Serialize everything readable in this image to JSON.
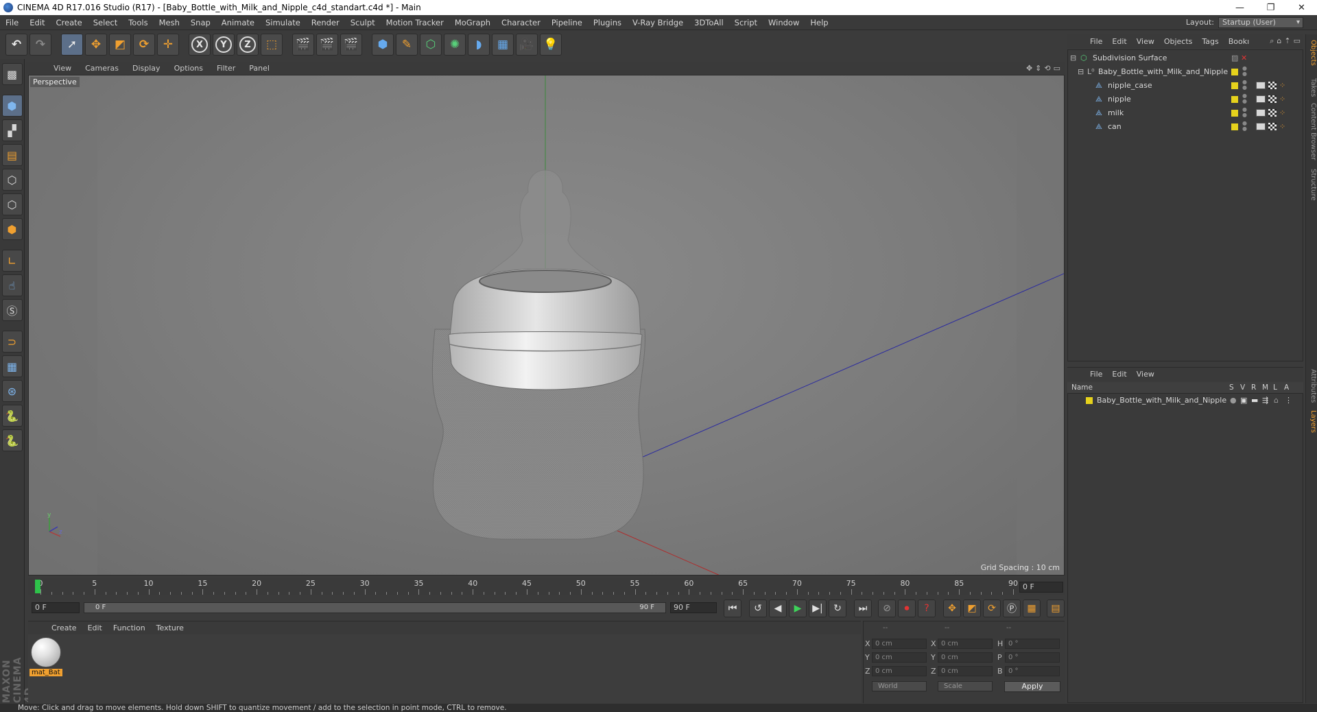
{
  "window": {
    "title": "CINEMA 4D R17.016 Studio (R17) - [Baby_Bottle_with_Milk_and_Nipple_c4d_standart.c4d *] - Main",
    "controls": [
      "—",
      "❐",
      "✕"
    ]
  },
  "menubar": {
    "items": [
      "File",
      "Edit",
      "Create",
      "Select",
      "Tools",
      "Mesh",
      "Snap",
      "Animate",
      "Simulate",
      "Render",
      "Sculpt",
      "Motion Tracker",
      "MoGraph",
      "Character",
      "Pipeline",
      "Plugins",
      "V-Ray Bridge",
      "3DToAll",
      "Script",
      "Window",
      "Help"
    ],
    "layout_label": "Layout:",
    "layout_value": "Startup (User)"
  },
  "viewport": {
    "menu": [
      "View",
      "Cameras",
      "Display",
      "Options",
      "Filter",
      "Panel"
    ],
    "camera_label": "Perspective",
    "grid_spacing": "Grid Spacing : 10 cm",
    "axis_y": "y",
    "axis_z": "z"
  },
  "timeline": {
    "ticks": [
      "0",
      "5",
      "10",
      "15",
      "20",
      "25",
      "30",
      "35",
      "40",
      "45",
      "50",
      "55",
      "60",
      "65",
      "70",
      "75",
      "80",
      "85",
      "90"
    ],
    "current_frame": "0 F",
    "start_field": "0 F",
    "range_start": "0 F",
    "range_end": "90 F",
    "end_field": "90 F"
  },
  "material_manager": {
    "menu": [
      "Create",
      "Edit",
      "Function",
      "Texture"
    ],
    "materials": [
      "mat_Bat"
    ]
  },
  "coordinates": {
    "headers": [
      "--",
      "--",
      "--"
    ],
    "rows": [
      {
        "a1": "X",
        "v1": "0 cm",
        "a2": "X",
        "v2": "0 cm",
        "a3": "H",
        "v3": "0 °"
      },
      {
        "a1": "Y",
        "v1": "0 cm",
        "a2": "Y",
        "v2": "0 cm",
        "a3": "P",
        "v3": "0 °"
      },
      {
        "a1": "Z",
        "v1": "0 cm",
        "a2": "Z",
        "v2": "0 cm",
        "a3": "B",
        "v3": "0 °"
      }
    ],
    "space": "World",
    "mode": "Scale",
    "apply": "Apply"
  },
  "object_manager": {
    "menu": [
      "File",
      "Edit",
      "View",
      "Objects",
      "Tags",
      "Bookı"
    ],
    "objects": [
      {
        "name": "Subdivision Surface"
      },
      {
        "name": "Baby_Bottle_with_Milk_and_Nipple"
      },
      {
        "name": "nipple_case"
      },
      {
        "name": "nipple"
      },
      {
        "name": "milk"
      },
      {
        "name": "can"
      }
    ]
  },
  "layer_manager": {
    "menu": [
      "File",
      "Edit",
      "View"
    ],
    "columns": [
      "Name",
      "S",
      "V",
      "R",
      "M",
      "L",
      "A"
    ],
    "layers": [
      "Baby_Bottle_with_Milk_and_Nipple"
    ]
  },
  "right_tabs": [
    "Objects",
    "Takes",
    "Content Browser",
    "Structure",
    "Attributes",
    "Layers"
  ],
  "maxon_logo": "MAXON CINEMA 4D",
  "status": "Move: Click and drag to move elements. Hold down SHIFT to quantize movement / add to the selection in point mode, CTRL to remove.",
  "colors": {
    "accent": "#f0a030",
    "layer_tag": "#e6d21c",
    "play_green": "#3ed35a",
    "record_red": "#e23434"
  }
}
